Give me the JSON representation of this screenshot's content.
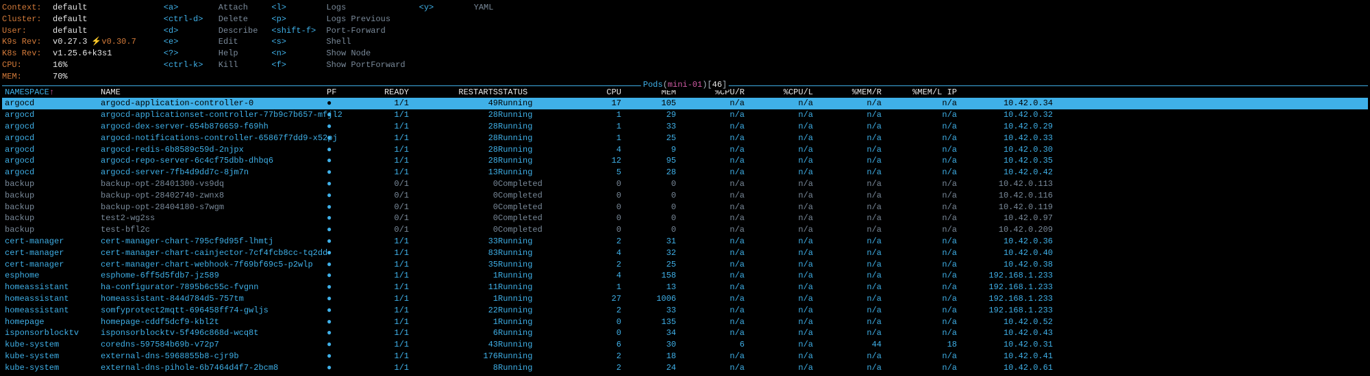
{
  "info": {
    "context_label": "Context:",
    "context_val": "default",
    "cluster_label": "Cluster:",
    "cluster_val": "default",
    "user_label": "User:",
    "user_val": "default",
    "k9s_rev_label": "K9s Rev:",
    "k9s_rev_val": "v0.27.3",
    "k9s_rev_update": "v0.30.7",
    "k8s_rev_label": "K8s Rev:",
    "k8s_rev_val": "v1.25.6+k3s1",
    "cpu_label": "CPU:",
    "cpu_val": "16%",
    "mem_label": "MEM:",
    "mem_val": "70%"
  },
  "hotkeys": {
    "col1": [
      {
        "key": "<a>",
        "label": "Attach"
      },
      {
        "key": "<ctrl-d>",
        "label": "Delete"
      },
      {
        "key": "<d>",
        "label": "Describe"
      },
      {
        "key": "<e>",
        "label": "Edit"
      },
      {
        "key": "<?>",
        "label": "Help"
      },
      {
        "key": "<ctrl-k>",
        "label": "Kill"
      }
    ],
    "col2": [
      {
        "key": "<l>",
        "label": "Logs"
      },
      {
        "key": "<p>",
        "label": "Logs Previous"
      },
      {
        "key": "<shift-f>",
        "label": "Port-Forward"
      },
      {
        "key": "<s>",
        "label": "Shell"
      },
      {
        "key": "<n>",
        "label": "Show Node"
      },
      {
        "key": "<f>",
        "label": "Show PortForward"
      }
    ],
    "col3": [
      {
        "key": "<y>",
        "label": "YAML"
      }
    ]
  },
  "title": {
    "label": "Pods",
    "ctx": "mini-01",
    "count": "46"
  },
  "columns": {
    "namespace": "NAMESPACE",
    "name": "NAME",
    "pf": "PF",
    "ready": "READY",
    "restarts": "RESTARTS",
    "status": "STATUS",
    "cpu": "CPU",
    "mem": "MEM",
    "cpu_r": "%CPU/R",
    "cpu_l": "%CPU/L",
    "mem_r": "%MEM/R",
    "mem_l": "%MEM/L",
    "ip": "IP"
  },
  "rows": [
    {
      "ns": "argocd",
      "name": "argocd-application-controller-0",
      "pf": "●",
      "ready": "1/1",
      "restarts": "49",
      "status": "Running",
      "cpu": "17",
      "mem": "105",
      "cpur": "n/a",
      "cpul": "n/a",
      "memr": "n/a",
      "meml": "n/a",
      "ip": "10.42.0.34",
      "sel": true,
      "completed": false
    },
    {
      "ns": "argocd",
      "name": "argocd-applicationset-controller-77b9c7b657-mfjl2",
      "pf": "●",
      "ready": "1/1",
      "restarts": "28",
      "status": "Running",
      "cpu": "1",
      "mem": "29",
      "cpur": "n/a",
      "cpul": "n/a",
      "memr": "n/a",
      "meml": "n/a",
      "ip": "10.42.0.32",
      "sel": false,
      "completed": false
    },
    {
      "ns": "argocd",
      "name": "argocd-dex-server-654b876659-f69hh",
      "pf": "●",
      "ready": "1/1",
      "restarts": "28",
      "status": "Running",
      "cpu": "1",
      "mem": "33",
      "cpur": "n/a",
      "cpul": "n/a",
      "memr": "n/a",
      "meml": "n/a",
      "ip": "10.42.0.29",
      "sel": false,
      "completed": false
    },
    {
      "ns": "argocd",
      "name": "argocd-notifications-controller-65867f7dd9-x52pj",
      "pf": "●",
      "ready": "1/1",
      "restarts": "28",
      "status": "Running",
      "cpu": "1",
      "mem": "25",
      "cpur": "n/a",
      "cpul": "n/a",
      "memr": "n/a",
      "meml": "n/a",
      "ip": "10.42.0.33",
      "sel": false,
      "completed": false
    },
    {
      "ns": "argocd",
      "name": "argocd-redis-6b8589c59d-2njpx",
      "pf": "●",
      "ready": "1/1",
      "restarts": "28",
      "status": "Running",
      "cpu": "4",
      "mem": "9",
      "cpur": "n/a",
      "cpul": "n/a",
      "memr": "n/a",
      "meml": "n/a",
      "ip": "10.42.0.30",
      "sel": false,
      "completed": false
    },
    {
      "ns": "argocd",
      "name": "argocd-repo-server-6c4cf75dbb-dhbq6",
      "pf": "●",
      "ready": "1/1",
      "restarts": "28",
      "status": "Running",
      "cpu": "12",
      "mem": "95",
      "cpur": "n/a",
      "cpul": "n/a",
      "memr": "n/a",
      "meml": "n/a",
      "ip": "10.42.0.35",
      "sel": false,
      "completed": false
    },
    {
      "ns": "argocd",
      "name": "argocd-server-7fb4d9dd7c-8jm7n",
      "pf": "●",
      "ready": "1/1",
      "restarts": "13",
      "status": "Running",
      "cpu": "5",
      "mem": "28",
      "cpur": "n/a",
      "cpul": "n/a",
      "memr": "n/a",
      "meml": "n/a",
      "ip": "10.42.0.42",
      "sel": false,
      "completed": false
    },
    {
      "ns": "backup",
      "name": "backup-opt-28401300-vs9dq",
      "pf": "●",
      "ready": "0/1",
      "restarts": "0",
      "status": "Completed",
      "cpu": "0",
      "mem": "0",
      "cpur": "n/a",
      "cpul": "n/a",
      "memr": "n/a",
      "meml": "n/a",
      "ip": "10.42.0.113",
      "sel": false,
      "completed": true
    },
    {
      "ns": "backup",
      "name": "backup-opt-28402740-zwnx8",
      "pf": "●",
      "ready": "0/1",
      "restarts": "0",
      "status": "Completed",
      "cpu": "0",
      "mem": "0",
      "cpur": "n/a",
      "cpul": "n/a",
      "memr": "n/a",
      "meml": "n/a",
      "ip": "10.42.0.116",
      "sel": false,
      "completed": true
    },
    {
      "ns": "backup",
      "name": "backup-opt-28404180-s7wgm",
      "pf": "●",
      "ready": "0/1",
      "restarts": "0",
      "status": "Completed",
      "cpu": "0",
      "mem": "0",
      "cpur": "n/a",
      "cpul": "n/a",
      "memr": "n/a",
      "meml": "n/a",
      "ip": "10.42.0.119",
      "sel": false,
      "completed": true
    },
    {
      "ns": "backup",
      "name": "test2-wg2ss",
      "pf": "●",
      "ready": "0/1",
      "restarts": "0",
      "status": "Completed",
      "cpu": "0",
      "mem": "0",
      "cpur": "n/a",
      "cpul": "n/a",
      "memr": "n/a",
      "meml": "n/a",
      "ip": "10.42.0.97",
      "sel": false,
      "completed": true
    },
    {
      "ns": "backup",
      "name": "test-bfl2c",
      "pf": "●",
      "ready": "0/1",
      "restarts": "0",
      "status": "Completed",
      "cpu": "0",
      "mem": "0",
      "cpur": "n/a",
      "cpul": "n/a",
      "memr": "n/a",
      "meml": "n/a",
      "ip": "10.42.0.209",
      "sel": false,
      "completed": true
    },
    {
      "ns": "cert-manager",
      "name": "cert-manager-chart-795cf9d95f-lhmtj",
      "pf": "●",
      "ready": "1/1",
      "restarts": "33",
      "status": "Running",
      "cpu": "2",
      "mem": "31",
      "cpur": "n/a",
      "cpul": "n/a",
      "memr": "n/a",
      "meml": "n/a",
      "ip": "10.42.0.36",
      "sel": false,
      "completed": false
    },
    {
      "ns": "cert-manager",
      "name": "cert-manager-chart-cainjector-7cf4fcb8cc-tq2dd",
      "pf": "●",
      "ready": "1/1",
      "restarts": "83",
      "status": "Running",
      "cpu": "4",
      "mem": "32",
      "cpur": "n/a",
      "cpul": "n/a",
      "memr": "n/a",
      "meml": "n/a",
      "ip": "10.42.0.40",
      "sel": false,
      "completed": false
    },
    {
      "ns": "cert-manager",
      "name": "cert-manager-chart-webhook-7f69bf69c5-p2wlp",
      "pf": "●",
      "ready": "1/1",
      "restarts": "35",
      "status": "Running",
      "cpu": "2",
      "mem": "25",
      "cpur": "n/a",
      "cpul": "n/a",
      "memr": "n/a",
      "meml": "n/a",
      "ip": "10.42.0.38",
      "sel": false,
      "completed": false
    },
    {
      "ns": "esphome",
      "name": "esphome-6ff5d5fdb7-jz589",
      "pf": "●",
      "ready": "1/1",
      "restarts": "1",
      "status": "Running",
      "cpu": "4",
      "mem": "158",
      "cpur": "n/a",
      "cpul": "n/a",
      "memr": "n/a",
      "meml": "n/a",
      "ip": "192.168.1.233",
      "sel": false,
      "completed": false
    },
    {
      "ns": "homeassistant",
      "name": "ha-configurator-7895b6c55c-fvgnn",
      "pf": "●",
      "ready": "1/1",
      "restarts": "11",
      "status": "Running",
      "cpu": "1",
      "mem": "13",
      "cpur": "n/a",
      "cpul": "n/a",
      "memr": "n/a",
      "meml": "n/a",
      "ip": "192.168.1.233",
      "sel": false,
      "completed": false
    },
    {
      "ns": "homeassistant",
      "name": "homeassistant-844d784d5-757tm",
      "pf": "●",
      "ready": "1/1",
      "restarts": "1",
      "status": "Running",
      "cpu": "27",
      "mem": "1006",
      "cpur": "n/a",
      "cpul": "n/a",
      "memr": "n/a",
      "meml": "n/a",
      "ip": "192.168.1.233",
      "sel": false,
      "completed": false
    },
    {
      "ns": "homeassistant",
      "name": "somfyprotect2mqtt-696458ff74-gwljs",
      "pf": "●",
      "ready": "1/1",
      "restarts": "22",
      "status": "Running",
      "cpu": "2",
      "mem": "33",
      "cpur": "n/a",
      "cpul": "n/a",
      "memr": "n/a",
      "meml": "n/a",
      "ip": "192.168.1.233",
      "sel": false,
      "completed": false
    },
    {
      "ns": "homepage",
      "name": "homepage-cddf5dcf9-kbl2t",
      "pf": "●",
      "ready": "1/1",
      "restarts": "1",
      "status": "Running",
      "cpu": "0",
      "mem": "135",
      "cpur": "n/a",
      "cpul": "n/a",
      "memr": "n/a",
      "meml": "n/a",
      "ip": "10.42.0.52",
      "sel": false,
      "completed": false
    },
    {
      "ns": "isponsorblocktv",
      "name": "isponsorblocktv-5f496c868d-wcq8t",
      "pf": "●",
      "ready": "1/1",
      "restarts": "6",
      "status": "Running",
      "cpu": "0",
      "mem": "34",
      "cpur": "n/a",
      "cpul": "n/a",
      "memr": "n/a",
      "meml": "n/a",
      "ip": "10.42.0.43",
      "sel": false,
      "completed": false
    },
    {
      "ns": "kube-system",
      "name": "coredns-597584b69b-v72p7",
      "pf": "●",
      "ready": "1/1",
      "restarts": "43",
      "status": "Running",
      "cpu": "6",
      "mem": "30",
      "cpur": "6",
      "cpul": "n/a",
      "memr": "44",
      "meml": "18",
      "ip": "10.42.0.31",
      "sel": false,
      "completed": false
    },
    {
      "ns": "kube-system",
      "name": "external-dns-5968855b8-cjr9b",
      "pf": "●",
      "ready": "1/1",
      "restarts": "176",
      "status": "Running",
      "cpu": "2",
      "mem": "18",
      "cpur": "n/a",
      "cpul": "n/a",
      "memr": "n/a",
      "meml": "n/a",
      "ip": "10.42.0.41",
      "sel": false,
      "completed": false
    },
    {
      "ns": "kube-system",
      "name": "external-dns-pihole-6b7464d4f7-2bcm8",
      "pf": "●",
      "ready": "1/1",
      "restarts": "8",
      "status": "Running",
      "cpu": "2",
      "mem": "24",
      "cpur": "n/a",
      "cpul": "n/a",
      "memr": "n/a",
      "meml": "n/a",
      "ip": "10.42.0.61",
      "sel": false,
      "completed": false
    }
  ]
}
